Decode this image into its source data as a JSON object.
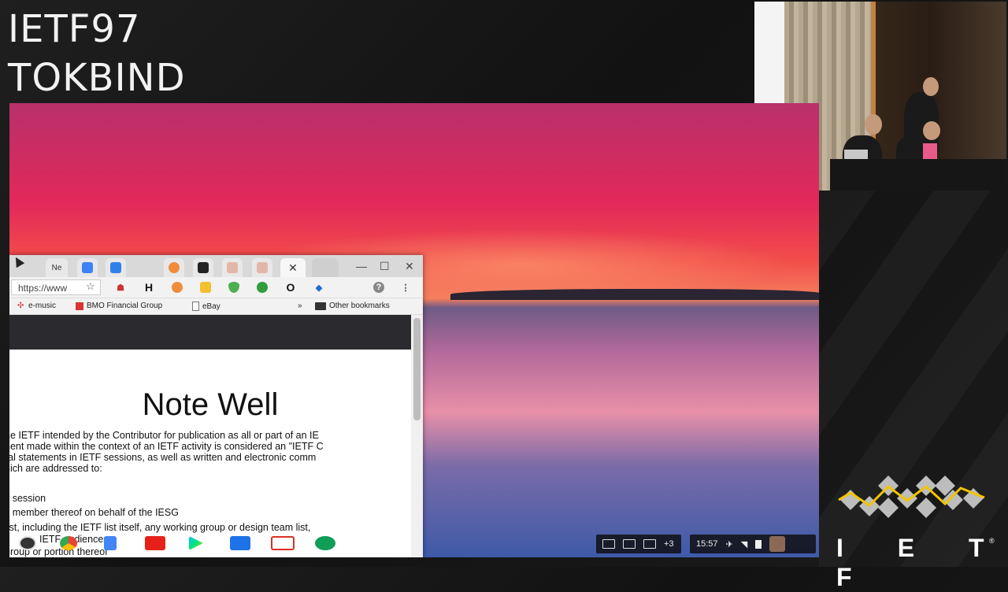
{
  "overlay": {
    "title_line1": "IETF97",
    "title_line2": "TOKBIND",
    "logo_text": "I E T F",
    "logo_mark": "®"
  },
  "browser": {
    "tabs": [
      {
        "label": "Ne",
        "icon": "new-tab-icon"
      },
      {
        "label": "",
        "icon": "dropbox-icon",
        "color": "#3b82f6"
      },
      {
        "label": "",
        "icon": "chat-icon",
        "color": "#2f80ed"
      },
      {
        "label": "",
        "icon": "at-icon",
        "color": "#f08c3a"
      },
      {
        "label": "",
        "icon": "m-icon",
        "color": "#222222"
      },
      {
        "label": "",
        "icon": "id-html-icon",
        "color": "#c87a6a"
      },
      {
        "label": "",
        "icon": "id-html-icon",
        "color": "#c87a6a"
      },
      {
        "label": "",
        "icon": "close-icon"
      }
    ],
    "window_controls": {
      "minimize": "—",
      "maximize": "☐",
      "close": "✕"
    },
    "url": "https://www",
    "extension_icons": [
      "ghost-icon",
      "h-icon",
      "orange-icon",
      "yellow-icon",
      "shield-icon",
      "green-circle-icon",
      "o-icon",
      "blue-icon",
      "menu-icon"
    ],
    "ext_h": "H",
    "ext_o": "O",
    "ext_menu": "⋮",
    "bookmarks": {
      "items": [
        "e-music",
        "BMO Financial Group",
        "eBay"
      ],
      "overflow": "»",
      "other": "Other bookmarks"
    },
    "page": {
      "title": "Note Well",
      "lines": [
        "he IETF intended by the Contributor for publication as all or part of an IE",
        "nent made within the context of an IETF activity is considered an \"IETF C",
        "ral statements in IETF sessions, as well as written and electronic comm",
        "hich are addressed to:",
        "y session",
        "y member thereof on behalf of the IESG",
        "list, including the IETF list itself, any working group or design team list,",
        "IETF audiences",
        "group or portion thereof"
      ]
    }
  },
  "shelf": {
    "apps": [
      "chrome-icon",
      "docs-icon",
      "youtube-icon",
      "play-store-icon",
      "tools-icon",
      "gmail-icon",
      "hangouts-icon"
    ],
    "notifications": "+3",
    "time": "15:57"
  }
}
